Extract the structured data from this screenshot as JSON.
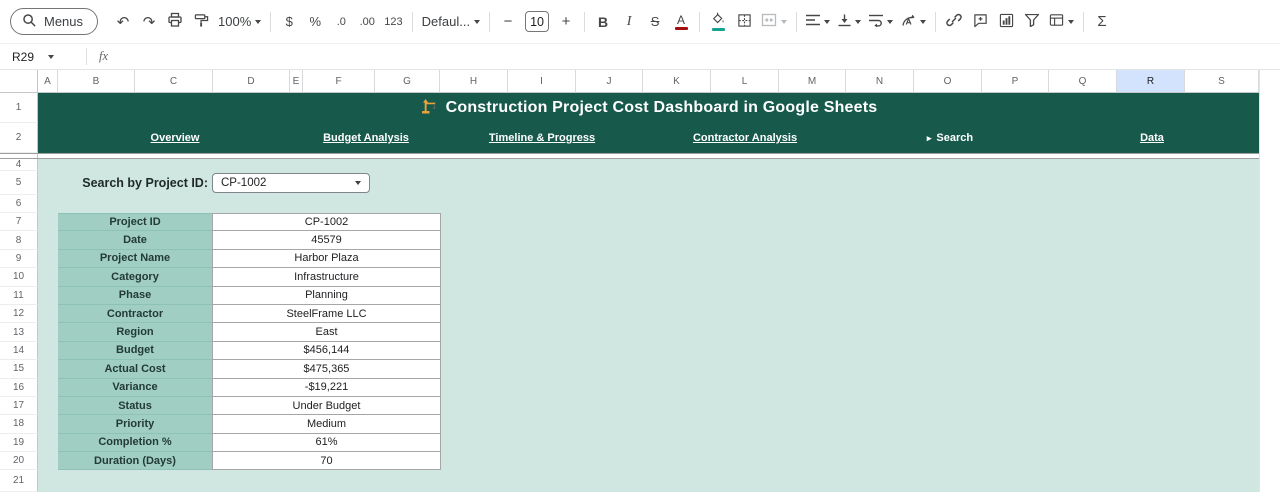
{
  "colors": {
    "banner_green": "#175a4b",
    "mint_background": "#cfe6e1",
    "label_column_teal": "#a0cec3",
    "selected_column_header": "#d3e3fd",
    "text_color_swatch": "#a50e0e",
    "fill_color_swatch": "#17a28c"
  },
  "toolbar": {
    "menus_label": "Menus",
    "undo_glyph": "↶",
    "redo_glyph": "↷",
    "zoom_value": "100%",
    "currency": "$",
    "percent": "%",
    "decimal_decrease": ".0",
    "decimal_increase": ".00",
    "more_formats": "123",
    "font_name": "Defaul...",
    "font_size_decrease": "−",
    "font_size": "10",
    "font_size_increase": "+",
    "bold": "B",
    "italic": "I",
    "strikethrough": "S",
    "text_color": "A",
    "functions": "Σ"
  },
  "formula_bar": {
    "name_box": "R29",
    "fx_label": "fx"
  },
  "grid": {
    "columns": [
      "A",
      "B",
      "C",
      "D",
      "E",
      "F",
      "G",
      "H",
      "I",
      "J",
      "K",
      "L",
      "M",
      "N",
      "O",
      "P",
      "Q",
      "R",
      "S"
    ],
    "selected_column": "R",
    "rows": [
      {
        "num": "1",
        "type": "banner"
      },
      {
        "num": "2",
        "type": "nav"
      },
      {
        "num": "",
        "type": "hidden"
      },
      {
        "num": "4",
        "type": "blank"
      },
      {
        "num": "5",
        "type": "search"
      },
      {
        "num": "6",
        "type": "blank"
      },
      {
        "num": "7",
        "type": "table",
        "field": 0
      },
      {
        "num": "8",
        "type": "table",
        "field": 1
      },
      {
        "num": "9",
        "type": "table",
        "field": 2
      },
      {
        "num": "10",
        "type": "table",
        "field": 3
      },
      {
        "num": "11",
        "type": "table",
        "field": 4
      },
      {
        "num": "12",
        "type": "table",
        "field": 5
      },
      {
        "num": "13",
        "type": "table",
        "field": 6
      },
      {
        "num": "14",
        "type": "table",
        "field": 7
      },
      {
        "num": "15",
        "type": "table",
        "field": 8
      },
      {
        "num": "16",
        "type": "table",
        "field": 9
      },
      {
        "num": "17",
        "type": "table",
        "field": 10
      },
      {
        "num": "18",
        "type": "table",
        "field": 11
      },
      {
        "num": "19",
        "type": "table",
        "field": 12
      },
      {
        "num": "20",
        "type": "table",
        "field": 13
      },
      {
        "num": "21",
        "type": "blank"
      }
    ]
  },
  "sheet": {
    "title_icon": "🏗️",
    "title": "Construction Project Cost Dashboard in Google Sheets",
    "nav": [
      {
        "label": "Overview",
        "underline": true
      },
      {
        "label": "Budget Analysis",
        "underline": true
      },
      {
        "label": "Timeline & Progress",
        "underline": true
      },
      {
        "label": "Contractor Analysis",
        "underline": true
      },
      {
        "label": "Search",
        "underline": false,
        "prefix": "▸"
      },
      {
        "label": "Data",
        "underline": true
      }
    ],
    "search": {
      "label": "Search by Project ID:",
      "value": "CP-1002"
    },
    "table": {
      "rows": [
        {
          "label": "Project ID",
          "value": "CP-1002"
        },
        {
          "label": "Date",
          "value": "45579"
        },
        {
          "label": "Project Name",
          "value": "Harbor Plaza"
        },
        {
          "label": "Category",
          "value": "Infrastructure"
        },
        {
          "label": "Phase",
          "value": "Planning"
        },
        {
          "label": "Contractor",
          "value": "SteelFrame LLC"
        },
        {
          "label": "Region",
          "value": "East"
        },
        {
          "label": "Budget",
          "value": "$456,144"
        },
        {
          "label": "Actual Cost",
          "value": "$475,365"
        },
        {
          "label": "Variance",
          "value": "-$19,221"
        },
        {
          "label": "Status",
          "value": "Under Budget"
        },
        {
          "label": "Priority",
          "value": "Medium"
        },
        {
          "label": "Completion %",
          "value": "61%"
        },
        {
          "label": "Duration (Days)",
          "value": "70"
        }
      ]
    }
  }
}
